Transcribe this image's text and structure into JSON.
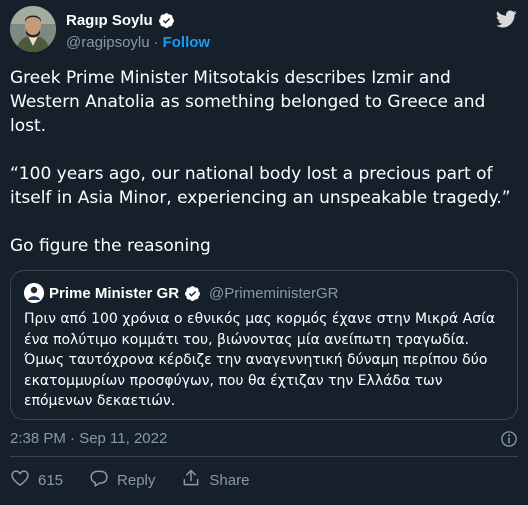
{
  "author": {
    "display_name": "Ragıp Soylu",
    "handle": "@ragipsoylu",
    "separator": "·",
    "follow_label": "Follow"
  },
  "tweet": {
    "text": "Greek Prime Minister Mitsotakis describes Izmir and Western Anatolia as something belonged to Greece and lost.\n\n“100 years ago, our national body lost a precious part of itself in Asia Minor, experiencing an unspeakable tragedy.”\n\nGo figure the reasoning"
  },
  "quoted_tweet": {
    "display_name": "Prime Minister GR",
    "handle": "@PrimeministerGR",
    "text": "Πριν από 100 χρόνια ο εθνικός μας κορμός έχανε στην Μικρά Ασία ένα πολύτιμο κομμάτι του, βιώνοντας μία ανείπωτη τραγωδία. Όμως ταυτόχρονα κέρδιζε την αναγεννητική δύναμη περίπου δύο εκατομμυρίων προσφύγων, που θα έχτιζαν την Ελλάδα των επόμενων δεκαετιών."
  },
  "meta": {
    "timestamp": "2:38 PM · Sep 11, 2022"
  },
  "actions": {
    "like_count": "615",
    "reply_label": "Reply",
    "share_label": "Share"
  },
  "colors": {
    "background": "#15202b",
    "accent": "#1d9bf0",
    "muted": "#8b98a5",
    "border": "#38444d"
  },
  "icons": [
    "verified-badge-icon",
    "twitter-bird-icon",
    "info-icon",
    "heart-icon",
    "reply-icon",
    "share-icon"
  ]
}
